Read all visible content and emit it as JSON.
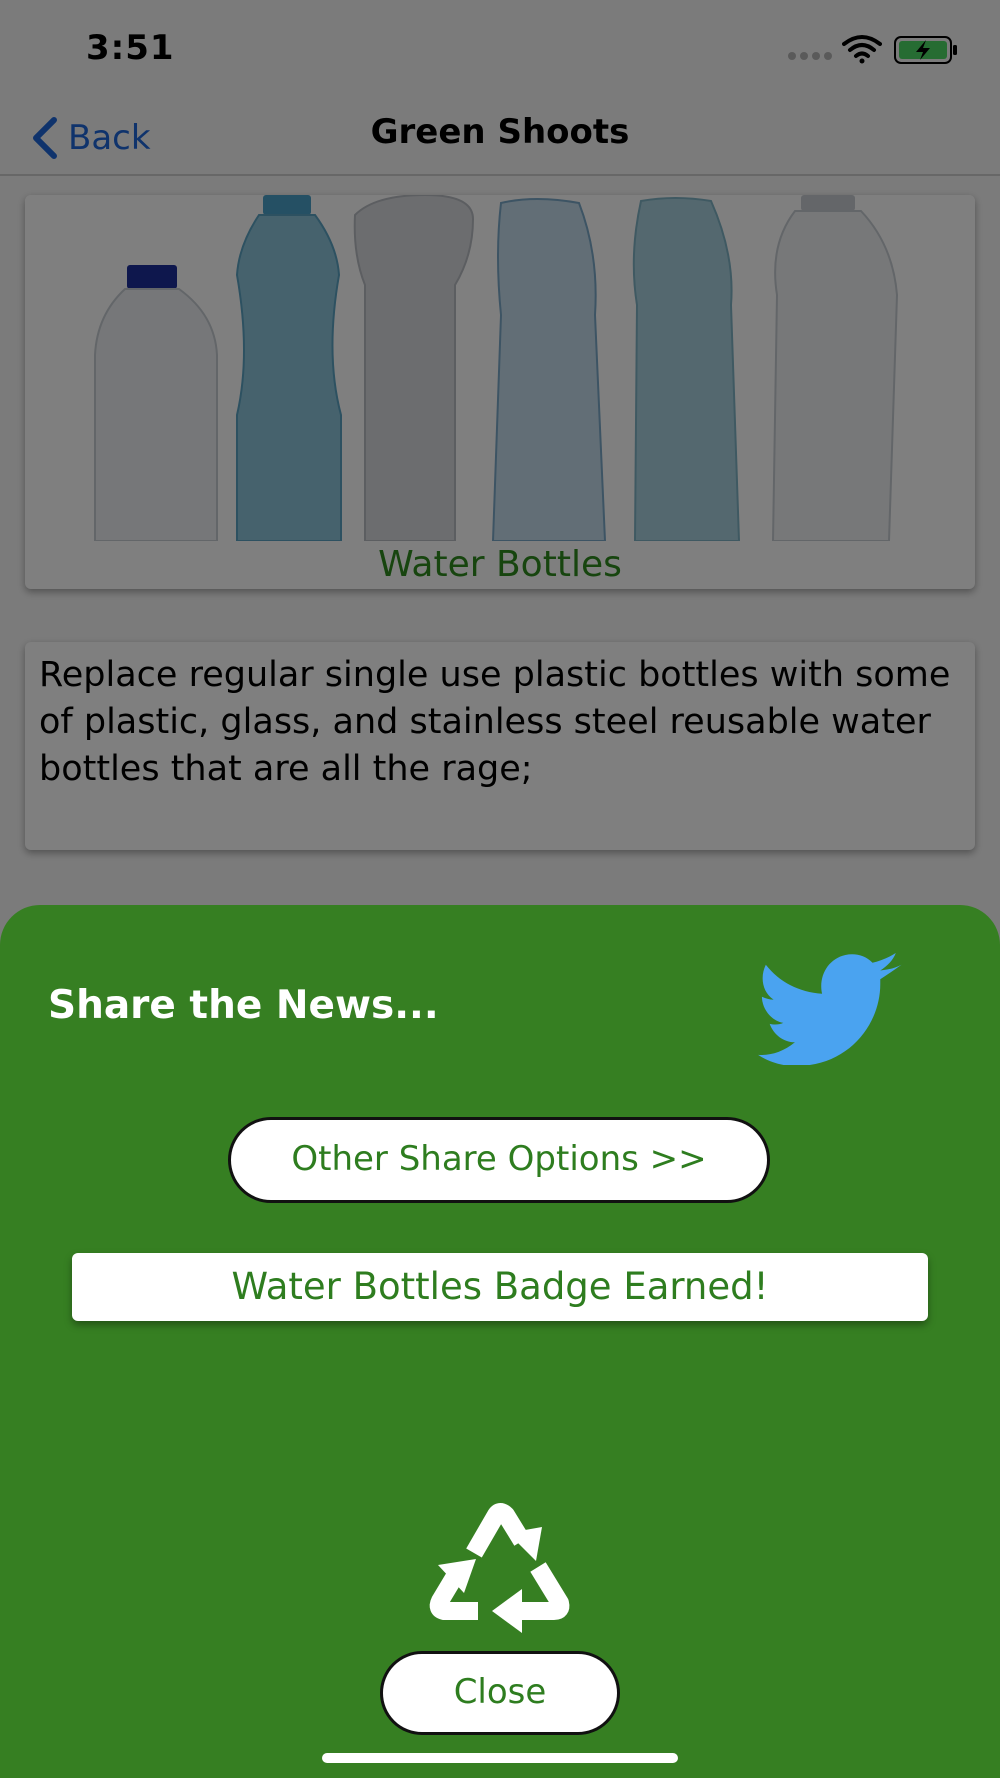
{
  "status_bar": {
    "time": "3:51"
  },
  "nav": {
    "back_label": "Back",
    "title": "Green Shoots"
  },
  "article": {
    "image_caption": "Water Bottles",
    "description": "Replace regular single use plastic bottles with some of plastic, glass, and stainless steel reusable water bottles that are all the rage;"
  },
  "share_sheet": {
    "title": "Share the News...",
    "other_share_label": "Other Share Options >>",
    "badge_text": "Water Bottles Badge Earned!",
    "close_label": "Close"
  },
  "icons": {
    "twitter": "twitter-bird-icon",
    "recycle": "recycle-icon",
    "back": "chevron-left-icon",
    "wifi": "wifi-icon",
    "battery": "battery-charging-icon"
  },
  "colors": {
    "accent_green": "#367f22",
    "text_green": "#2e7d1f",
    "ios_blue": "#1f66d8",
    "twitter_blue": "#4aa3f0"
  }
}
